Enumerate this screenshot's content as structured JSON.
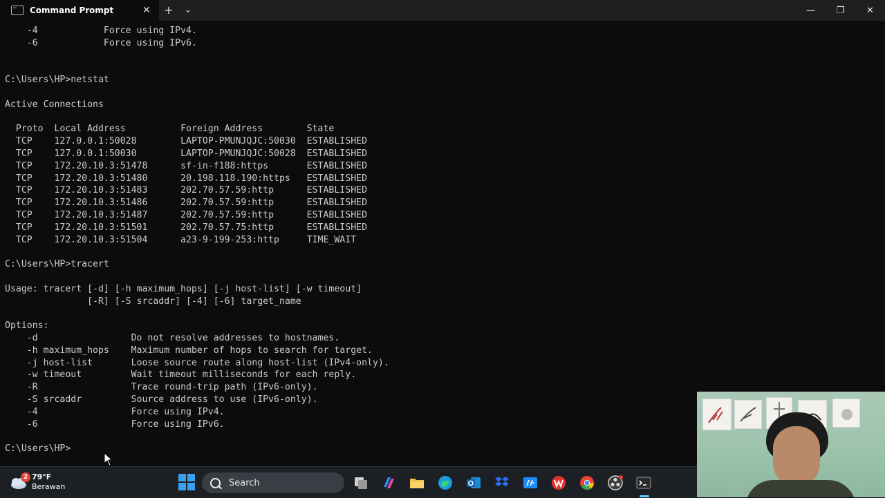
{
  "window": {
    "tab_title": "Command Prompt",
    "tab_close": "✕",
    "new_tab": "+",
    "tab_dropdown": "⌄",
    "minimize": "—",
    "maximize": "❐",
    "close": "✕"
  },
  "terminal": {
    "lines": [
      "    -4            Force using IPv4.",
      "    -6            Force using IPv6.",
      "",
      "",
      "C:\\Users\\HP>netstat",
      "",
      "Active Connections",
      "",
      "  Proto  Local Address          Foreign Address        State",
      "  TCP    127.0.0.1:50028        LAPTOP-PMUNJQJC:50030  ESTABLISHED",
      "  TCP    127.0.0.1:50030        LAPTOP-PMUNJQJC:50028  ESTABLISHED",
      "  TCP    172.20.10.3:51478      sf-in-f188:https       ESTABLISHED",
      "  TCP    172.20.10.3:51480      20.198.118.190:https   ESTABLISHED",
      "  TCP    172.20.10.3:51483      202.70.57.59:http      ESTABLISHED",
      "  TCP    172.20.10.3:51486      202.70.57.59:http      ESTABLISHED",
      "  TCP    172.20.10.3:51487      202.70.57.59:http      ESTABLISHED",
      "  TCP    172.20.10.3:51501      202.70.57.75:http      ESTABLISHED",
      "  TCP    172.20.10.3:51504      a23-9-199-253:http     TIME_WAIT",
      "",
      "C:\\Users\\HP>tracert",
      "",
      "Usage: tracert [-d] [-h maximum_hops] [-j host-list] [-w timeout]",
      "               [-R] [-S srcaddr] [-4] [-6] target_name",
      "",
      "Options:",
      "    -d                 Do not resolve addresses to hostnames.",
      "    -h maximum_hops    Maximum number of hops to search for target.",
      "    -j host-list       Loose source route along host-list (IPv4-only).",
      "    -w timeout         Wait timeout milliseconds for each reply.",
      "    -R                 Trace round-trip path (IPv6-only).",
      "    -S srcaddr         Source address to use (IPv6-only).",
      "    -4                 Force using IPv4.",
      "    -6                 Force using IPv6.",
      "",
      "C:\\Users\\HP>"
    ]
  },
  "taskbar": {
    "weather": {
      "badge": "2",
      "temp": "79°F",
      "condition": "Berawan"
    },
    "search_placeholder": "Search",
    "apps": [
      "task-view-icon",
      "copilot-icon",
      "file-explorer-icon",
      "edge-icon",
      "outlook-icon",
      "dropbox-icon",
      "hp-icon",
      "wps-office-icon",
      "chrome-icon",
      "obs-icon",
      "terminal-icon"
    ]
  },
  "colors": {
    "terminal_bg": "#0c0c0c",
    "terminal_fg": "#cccccc",
    "taskbar_bg": "#1c2024",
    "accent": "#60cdff"
  }
}
